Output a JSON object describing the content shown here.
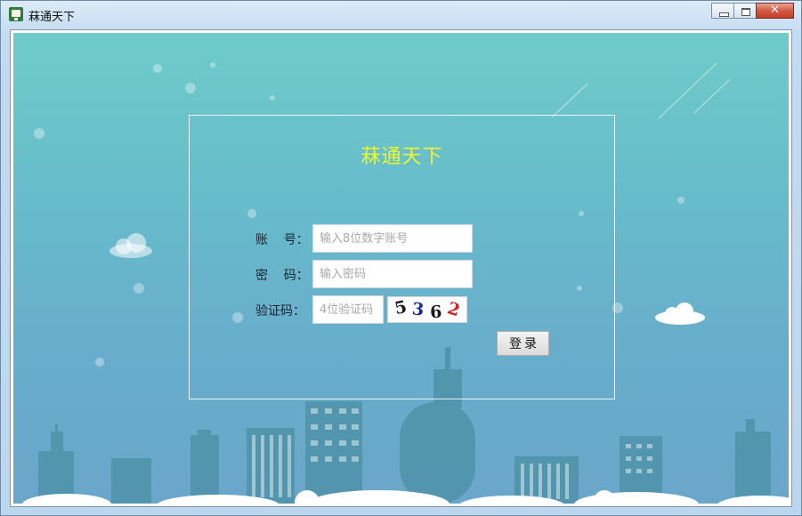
{
  "window": {
    "title": "菻通天下",
    "close_glyph": "✕"
  },
  "app": {
    "heading": "菻通天下"
  },
  "form": {
    "account_label": "账    号：",
    "account_placeholder": "输入8位数字账号",
    "password_label": "密    码：",
    "password_placeholder": "输入密码",
    "captcha_label": "验证码：",
    "captcha_placeholder": "4位验证码",
    "captcha_chars": [
      "5",
      "3",
      "6",
      "2"
    ],
    "captcha_colors": [
      "#1a1a1a",
      "#1b2a9a",
      "#1a1a1a",
      "#d22020"
    ],
    "login_label": "登录"
  },
  "colors": {
    "accent_title": "#f1f62a",
    "sky_top": "#6ecbc9",
    "sky_bottom": "#6aa6ca"
  }
}
